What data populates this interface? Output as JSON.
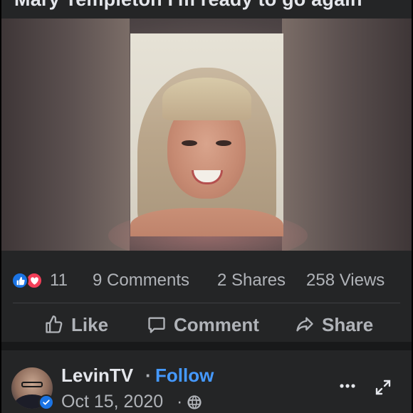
{
  "post": {
    "caption": "Mary Templeton I'm ready to go again"
  },
  "stats": {
    "reaction_count": "11",
    "comments": "9 Comments",
    "shares": "2 Shares",
    "views": "258 Views"
  },
  "actions": {
    "like": "Like",
    "comment": "Comment",
    "share": "Share"
  },
  "author": {
    "name": "LevinTV",
    "separator": "·",
    "follow": "Follow",
    "date": "Oct 15, 2020",
    "date_separator": "·"
  },
  "colors": {
    "background": "#242526",
    "accent_blue": "#4599ff",
    "like_blue": "#1b74e4",
    "love_red": "#f33e58",
    "muted_text": "#b0b3b8",
    "primary_text": "#e4e6eb"
  },
  "icons": [
    "like-reaction-icon",
    "love-reaction-icon",
    "thumbs-up-icon",
    "comment-icon",
    "share-arrow-icon",
    "verified-badge-icon",
    "globe-icon",
    "more-options-icon",
    "expand-icon"
  ]
}
